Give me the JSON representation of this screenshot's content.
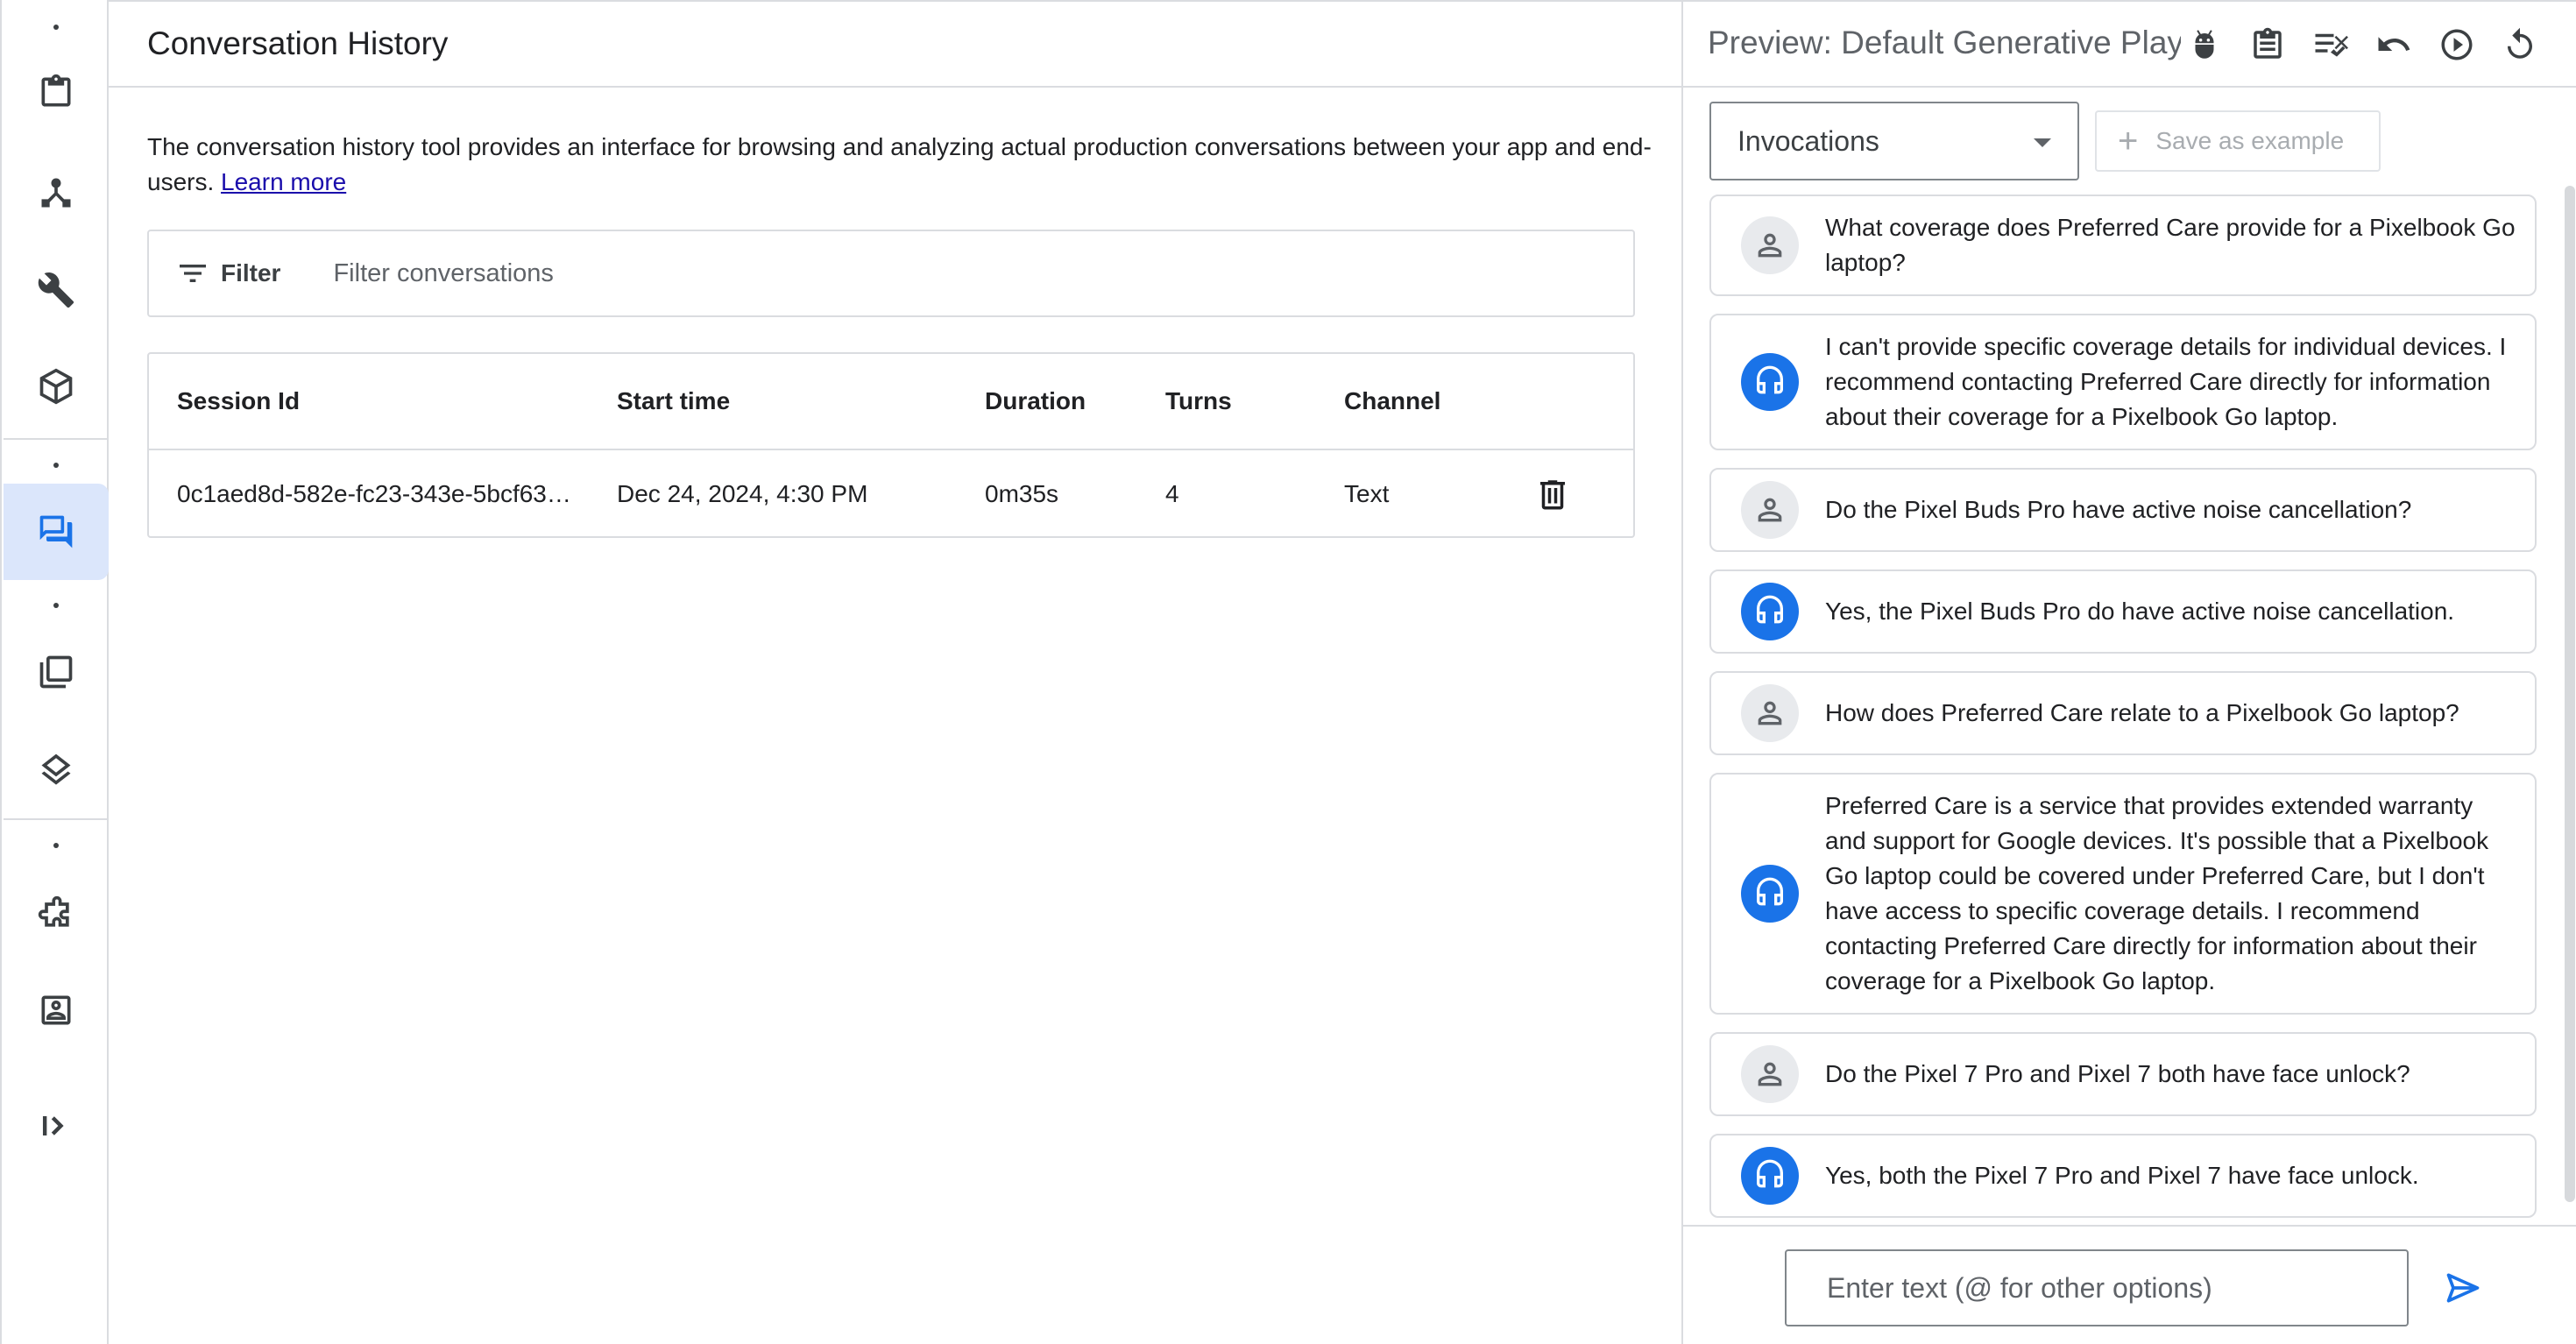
{
  "rail": {
    "items": [
      {
        "name": "clipboard"
      },
      {
        "name": "flows"
      },
      {
        "name": "tools"
      },
      {
        "name": "package"
      },
      {
        "name": "conversation-history"
      },
      {
        "name": "library"
      },
      {
        "name": "layers"
      },
      {
        "name": "integrations"
      },
      {
        "name": "contact"
      },
      {
        "name": "expand"
      }
    ],
    "active": "conversation-history"
  },
  "main": {
    "title": "Conversation History",
    "intro_text": "The conversation history tool provides an interface for browsing and analyzing actual production conversations between your app and end-users. ",
    "learn_more": "Learn more",
    "filter": {
      "label": "Filter",
      "placeholder": "Filter conversations"
    },
    "table": {
      "headers": {
        "session": "Session Id",
        "start": "Start time",
        "duration": "Duration",
        "turns": "Turns",
        "channel": "Channel"
      },
      "rows": [
        {
          "session": "0c1aed8d-582e-fc23-343e-5bcf63…",
          "start": "Dec 24, 2024, 4:30 PM",
          "duration": "0m35s",
          "turns": "4",
          "channel": "Text"
        }
      ]
    }
  },
  "preview": {
    "title": "Preview: Default Generative Playl",
    "toolbar_icons": [
      "bug-icon",
      "clipboard-icon",
      "compare-icon",
      "undo-icon",
      "play-icon",
      "reset-icon"
    ],
    "dropdown_value": "Invocations",
    "save_label": "Save as example",
    "messages": [
      {
        "role": "user",
        "text": "What coverage does Preferred Care provide for a Pixelbook Go laptop?"
      },
      {
        "role": "agent",
        "text": "I can't provide specific coverage details for individual devices. I recommend contacting Preferred Care directly for information about their coverage for a Pixelbook Go laptop."
      },
      {
        "role": "user",
        "text": "Do the Pixel Buds Pro have active noise cancellation?"
      },
      {
        "role": "agent",
        "text": "Yes, the Pixel Buds Pro do have active noise cancellation."
      },
      {
        "role": "user",
        "text": "How does Preferred Care relate to a Pixelbook Go laptop?"
      },
      {
        "role": "agent",
        "text": "Preferred Care is a service that provides extended warranty and support for Google devices. It's possible that a Pixelbook Go laptop could be covered under Preferred Care, but I don't have access to specific coverage details. I recommend contacting Preferred Care directly for information about their coverage for a Pixelbook Go laptop."
      },
      {
        "role": "user",
        "text": "Do the Pixel 7 Pro and Pixel 7 both have face unlock?"
      },
      {
        "role": "agent",
        "text": "Yes, both the Pixel 7 Pro and Pixel 7 have face unlock."
      }
    ],
    "composer_placeholder": "Enter text (@ for other options)"
  },
  "colors": {
    "accent": "#1a73e8",
    "active_rail": "#dbe6fb",
    "border": "#dadce0"
  }
}
